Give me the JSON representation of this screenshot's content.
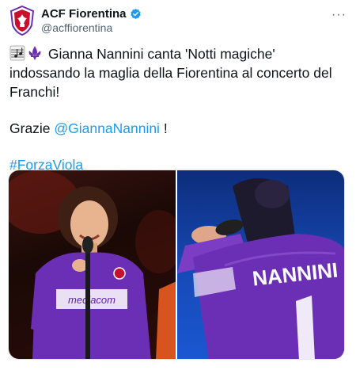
{
  "account": {
    "display_name": "ACF Fiorentina",
    "handle": "@acffiorentina",
    "verified": true,
    "avatar_icon": "fiorentina-crest-icon"
  },
  "more_icon": "more-options-icon",
  "more_label": "···",
  "tweet": {
    "line1": "Gianna Nannini canta 'Notti magiche' indossando la maglia della Fiorentina al concerto del Franchi!",
    "line2_prefix": "Grazie ",
    "mention": "@GiannaNannini",
    "line2_suffix": " !",
    "hashtag": "#ForzaViola",
    "leading_emojis": [
      "musical-score-emoji",
      "fleur-de-lis-emoji"
    ]
  },
  "media": {
    "photos": [
      {
        "name": "photo-singer-microphone"
      },
      {
        "name": "photo-jersey-back"
      }
    ],
    "jersey_back_text": "NANNINI",
    "jersey_front_text": "mediacom"
  },
  "colors": {
    "link": "#1d9bf0",
    "jersey_purple": "#6b2fb5",
    "verified": "#1d9bf0"
  }
}
